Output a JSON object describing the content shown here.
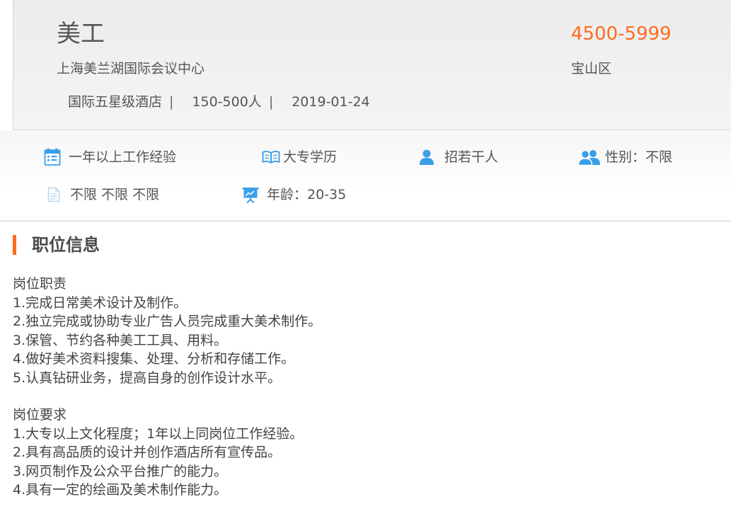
{
  "job": {
    "title": "美工",
    "salary": "4500-5999",
    "company": "上海美兰湖国际会议中心",
    "district": "宝山区",
    "meta": {
      "company_type": "国际五星级酒店",
      "separator": "|",
      "company_size": "150-500人",
      "date": "2019-01-24"
    }
  },
  "requirements": {
    "experience": "一年以上工作经验",
    "education": "大专学历",
    "headcount": "招若干人",
    "gender": "性别：不限",
    "other": "不限 不限 不限",
    "age": "年龄：20-35",
    "icon_color": "#3a9ee8"
  },
  "section": {
    "title": "职位信息",
    "accent_color": "#ff6a1e"
  },
  "description": {
    "duties_heading": "岗位职责",
    "duties": [
      "1.完成日常美术设计及制作。",
      "2.独立完成或协助专业广告人员完成重大美术制作。",
      "3.保管、节约各种美工工具、用料。",
      "4.做好美术资料搜集、处理、分析和存储工作。",
      "5.认真钻研业务，提高自身的创作设计水平。"
    ],
    "requirements_heading": "岗位要求",
    "requirements": [
      "1.大专以上文化程度；1年以上同岗位工作经验。",
      "2.具有高品质的设计并创作酒店所有宣传品。",
      "3.网页制作及公众平台推广的能力。",
      "4.具有一定的绘画及美术制作能力。"
    ]
  }
}
